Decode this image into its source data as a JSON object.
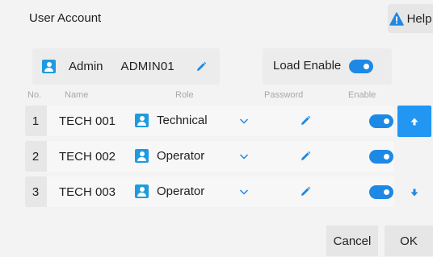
{
  "header": {
    "title": "User Account",
    "help_label": "Help"
  },
  "admin": {
    "name": "Admin",
    "id": "ADMIN01"
  },
  "load": {
    "label": "Load Enable",
    "enabled": true
  },
  "columns": {
    "no": "No.",
    "name": "Name",
    "role": "Role",
    "password": "Password",
    "enable": "Enable"
  },
  "users": [
    {
      "no": "1",
      "name": "TECH  001",
      "role": "Technical",
      "enabled": true
    },
    {
      "no": "2",
      "name": "TECH  002",
      "role": "Operator",
      "enabled": true
    },
    {
      "no": "3",
      "name": "TECH  003",
      "role": "Operator",
      "enabled": true
    }
  ],
  "footer": {
    "cancel_label": "Cancel",
    "ok_label": "OK"
  },
  "colors": {
    "accent": "#2196f3",
    "toggle": "#1e88e5",
    "user_icon": "#1e9be0",
    "warning": "#1e88e5"
  },
  "icons": [
    "warning-icon",
    "user-icon",
    "pencil-icon",
    "chevron-down-icon",
    "arrow-up-icon",
    "arrow-down-icon",
    "toggle-switch"
  ]
}
